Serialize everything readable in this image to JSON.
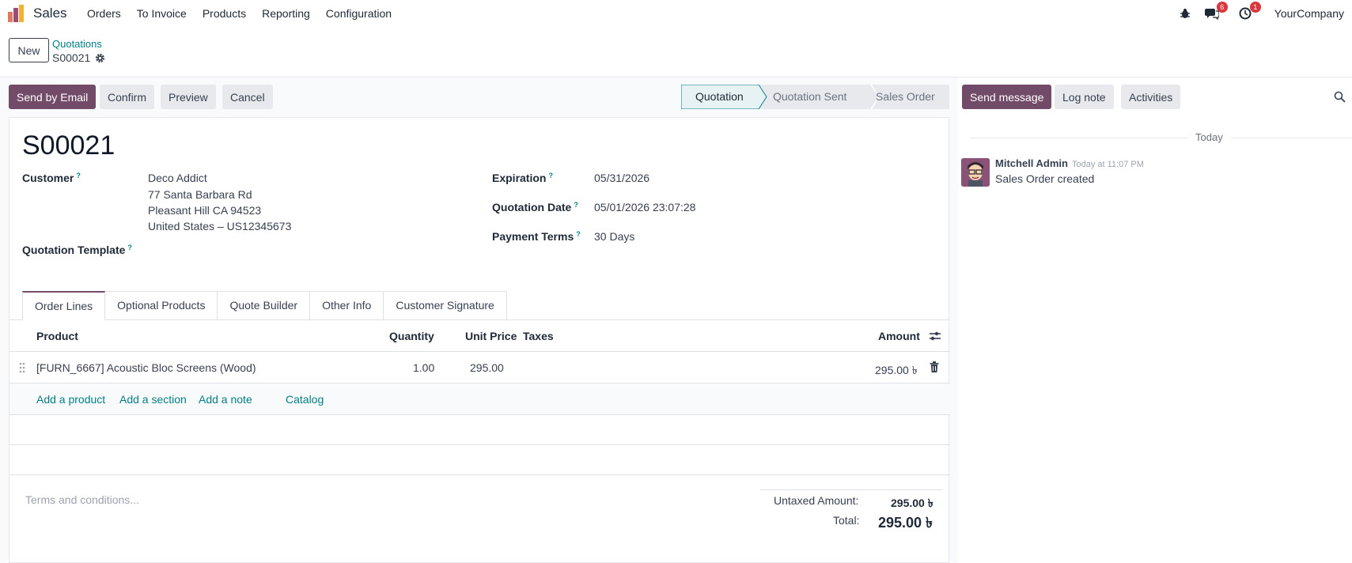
{
  "navbar": {
    "app_name": "Sales",
    "menu": [
      "Orders",
      "To Invoice",
      "Products",
      "Reporting",
      "Configuration"
    ],
    "messages_count": "6",
    "activities_count": "1",
    "company": "YourCompany"
  },
  "control": {
    "new_label": "New",
    "breadcrumb": "Quotations",
    "record": "S00021"
  },
  "actions": {
    "send_email": "Send by Email",
    "confirm": "Confirm",
    "preview": "Preview",
    "cancel": "Cancel"
  },
  "status": {
    "steps": [
      "Quotation",
      "Quotation Sent",
      "Sales Order"
    ],
    "active": "Quotation"
  },
  "form": {
    "title": "S00021",
    "customer_label": "Customer",
    "customer_lines": [
      "Deco Addict",
      "77 Santa Barbara Rd",
      "Pleasant Hill CA 94523",
      "United States – US12345673"
    ],
    "template_label": "Quotation Template",
    "expiration_label": "Expiration",
    "expiration": "05/31/2026",
    "date_label": "Quotation Date",
    "date": "05/01/2026 23:07:28",
    "terms_label": "Payment Terms",
    "terms": "30 Days",
    "help_mark": "?"
  },
  "tabs": [
    "Order Lines",
    "Optional Products",
    "Quote Builder",
    "Other Info",
    "Customer Signature"
  ],
  "table": {
    "headers": {
      "product": "Product",
      "quantity": "Quantity",
      "unit_price": "Unit Price",
      "taxes": "Taxes",
      "amount": "Amount"
    },
    "rows": [
      {
        "product": "[FURN_6667] Acoustic Bloc Screens (Wood)",
        "quantity": "1.00",
        "unit_price": "295.00",
        "taxes": "",
        "amount": "295.00 ৳"
      }
    ],
    "add_product": "Add a product",
    "add_section": "Add a section",
    "add_note": "Add a note",
    "catalog": "Catalog"
  },
  "footer": {
    "terms_placeholder": "Terms and conditions...",
    "untaxed_label": "Untaxed Amount:",
    "untaxed": "295.00 ৳",
    "total_label": "Total:",
    "total": "295.00 ৳"
  },
  "chatter": {
    "send_message": "Send message",
    "log_note": "Log note",
    "activities": "Activities",
    "date_sep": "Today",
    "author": "Mitchell Admin",
    "time": "Today at 11:07 PM",
    "message": "Sales Order created"
  },
  "colors": {
    "brand": "#714b67",
    "accent": "#017e84",
    "badge": "#d9363e"
  }
}
